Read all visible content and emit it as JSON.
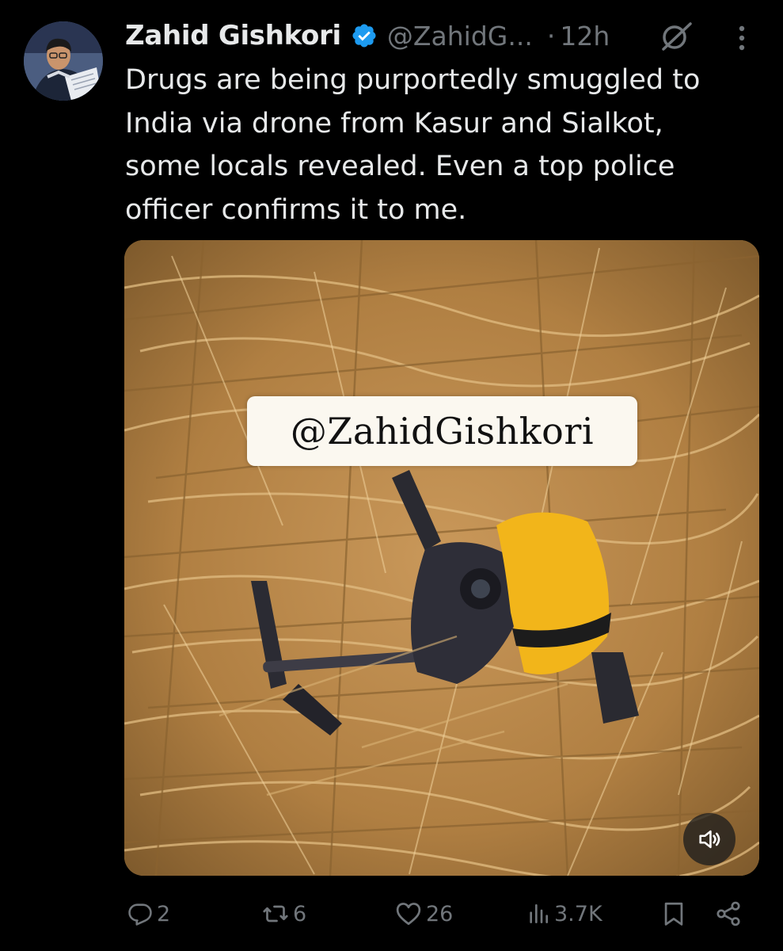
{
  "tweet": {
    "author": {
      "display_name": "Zahid Gishkori",
      "handle": "@ZahidG...",
      "avatar_icon": "user-avatar"
    },
    "meta": {
      "separator": "·",
      "time": "12h"
    },
    "text_lines": [
      "Drugs are being purportedly smuggled to",
      "India via drone from Kasur and Sialkot,",
      "some locals revealed. Even a top police",
      "officer confirms it to me."
    ],
    "media": {
      "watermark": "@ZahidGishkori",
      "sound_icon": "speaker-icon"
    },
    "actions": {
      "replies": "2",
      "reposts": "6",
      "likes": "26",
      "views": "3.7K"
    }
  },
  "colors": {
    "background": "#000000",
    "text_primary": "#e7e9ea",
    "text_secondary": "#71767b",
    "verified": "#1d9bf0"
  }
}
